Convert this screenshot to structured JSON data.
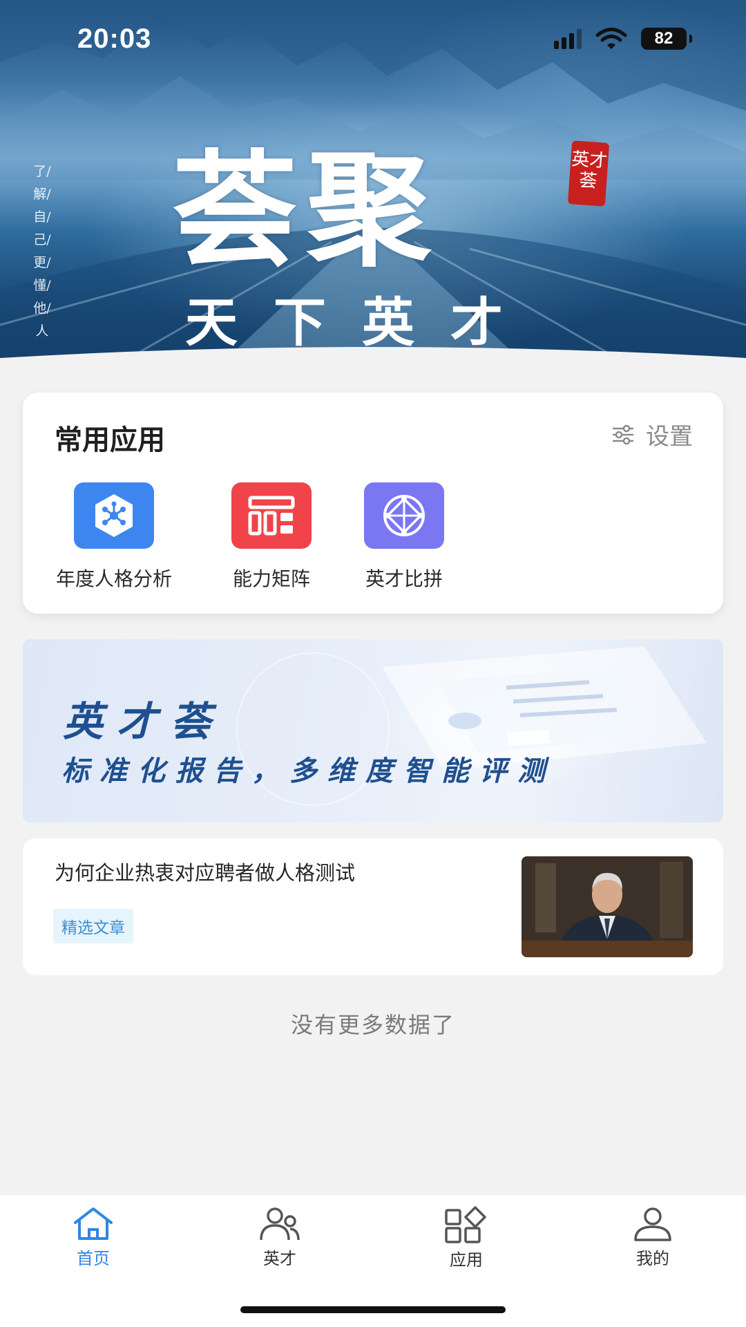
{
  "status_bar": {
    "time": "20:03",
    "battery": "82",
    "icons": [
      "signal-icon",
      "wifi-icon",
      "battery-icon"
    ]
  },
  "hero": {
    "vertical_text": "了/解/自/己/更/懂/他/人",
    "title": "荟聚",
    "subtitle": "天下英才",
    "seal_text": "英才荟"
  },
  "apps_card": {
    "title": "常用应用",
    "settings_label": "设置",
    "apps": [
      {
        "label": "年度人格分析",
        "icon": "network-hexagon-icon",
        "color": "#3d86ef"
      },
      {
        "label": "能力矩阵",
        "icon": "matrix-grid-icon",
        "color": "#f0434a"
      },
      {
        "label": "英才比拼",
        "icon": "compass-orbit-icon",
        "color": "#7b76f2"
      }
    ]
  },
  "banner": {
    "title": "英才荟",
    "subtitle": "标准化报告，多维度智能评测"
  },
  "article": {
    "title": "为何企业热衷对应聘者做人格测试",
    "tag": "精选文章"
  },
  "footer_note": "没有更多数据了",
  "tabbar": {
    "active_color": "#2f86e6",
    "tabs": [
      {
        "label": "首页",
        "icon": "home-icon",
        "active": true
      },
      {
        "label": "英才",
        "icon": "people-icon",
        "active": false
      },
      {
        "label": "应用",
        "icon": "apps-grid-icon",
        "active": false
      },
      {
        "label": "我的",
        "icon": "user-icon",
        "active": false
      }
    ]
  }
}
